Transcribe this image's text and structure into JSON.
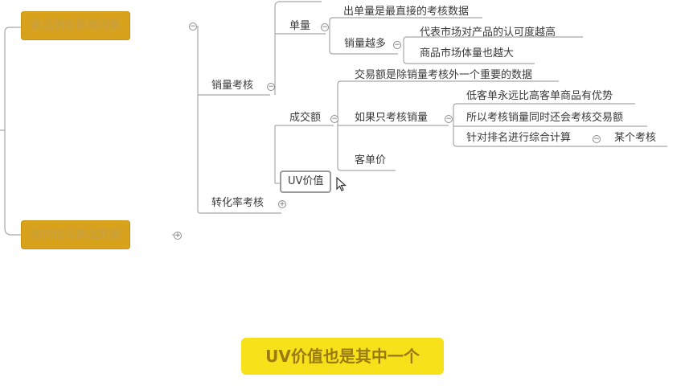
{
  "mindmap": {
    "main_topics": [
      {
        "label": "商品销售影响因素"
      },
      {
        "label": "如何优化商品数据"
      }
    ],
    "branches": {
      "sales_assessment": "销量考核",
      "conversion_assessment": "转化率考核"
    },
    "nodes": {
      "unit_volume": "单量",
      "unit_volume_note": "出单量是最直接的考核数据",
      "more_sales": "销量越多",
      "more_sales_note_1": "代表市场对产品的认可度越高",
      "more_sales_note_2": "商品市场体量也越大",
      "transaction_amount": "成交额",
      "transaction_note": "交易额是除销量考核外一个重要的数据",
      "if_only_sales": "如果只考核销量",
      "if_only_note_1": "低客单永远比高客单商品有优势",
      "if_only_note_2": "所以考核销量同时还会考核交易额",
      "ranking_calc": "针对排名进行综合计算",
      "some_assessment": "某个考核",
      "avg_order_value": "客单价",
      "uv_value": "UV价值"
    }
  },
  "subtitle": "UV价值也是其中一个",
  "colors": {
    "main_topic_bg": "#d8a21c",
    "subtitle_bg": "#f7e11a",
    "line": "#a8a8a8"
  }
}
